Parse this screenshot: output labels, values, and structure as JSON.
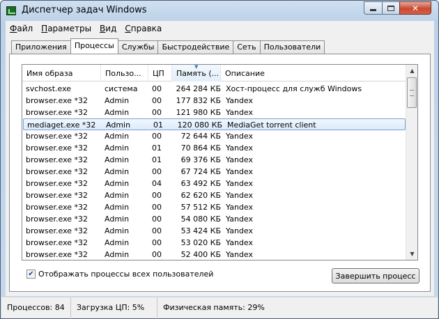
{
  "window": {
    "title": "Диспетчер задач Windows"
  },
  "menu": [
    {
      "pre": "",
      "key": "Ф",
      "post": "айл"
    },
    {
      "pre": "",
      "key": "П",
      "post": "араметры"
    },
    {
      "pre": "",
      "key": "В",
      "post": "ид"
    },
    {
      "pre": "",
      "key": "С",
      "post": "правка"
    }
  ],
  "tabs": [
    "Приложения",
    "Процессы",
    "Службы",
    "Быстродействие",
    "Сеть",
    "Пользователи"
  ],
  "active_tab": "Процессы",
  "columns": [
    "Имя образа",
    "Пользо...",
    "ЦП",
    "Память (...",
    "Описание"
  ],
  "rows": [
    [
      "svchost.exe",
      "система",
      "00",
      "264 284 КБ",
      "Хост-процесс для служб Windows"
    ],
    [
      "browser.exe *32",
      "Admin",
      "00",
      "177 832 КБ",
      "Yandex"
    ],
    [
      "browser.exe *32",
      "Admin",
      "00",
      "121 980 КБ",
      "Yandex"
    ],
    [
      "mediaget.exe *32",
      "Admin",
      "01",
      "120 080 КБ",
      "MediaGet torrent client"
    ],
    [
      "browser.exe *32",
      "Admin",
      "00",
      "72 644 КБ",
      "Yandex"
    ],
    [
      "browser.exe *32",
      "Admin",
      "01",
      "70 864 КБ",
      "Yandex"
    ],
    [
      "browser.exe *32",
      "Admin",
      "01",
      "69 376 КБ",
      "Yandex"
    ],
    [
      "browser.exe *32",
      "Admin",
      "00",
      "67 724 КБ",
      "Yandex"
    ],
    [
      "browser.exe *32",
      "Admin",
      "04",
      "63 492 КБ",
      "Yandex"
    ],
    [
      "browser.exe *32",
      "Admin",
      "00",
      "62 620 КБ",
      "Yandex"
    ],
    [
      "browser.exe *32",
      "Admin",
      "00",
      "57 512 КБ",
      "Yandex"
    ],
    [
      "browser.exe *32",
      "Admin",
      "00",
      "54 080 КБ",
      "Yandex"
    ],
    [
      "browser.exe *32",
      "Admin",
      "00",
      "53 424 КБ",
      "Yandex"
    ],
    [
      "browser.exe *32",
      "Admin",
      "00",
      "53 020 КБ",
      "Yandex"
    ],
    [
      "browser.exe *32",
      "Admin",
      "00",
      "52 400 КБ",
      "Yandex"
    ]
  ],
  "selected_row": 3,
  "show_all": {
    "label": "Отображать процессы всех пользователей",
    "checked": true
  },
  "end_process_label": "Завершить процесс",
  "status": {
    "processes": "Процессов: 84",
    "cpu": "Загрузка ЦП: 5%",
    "memory": "Физическая память: 29%"
  },
  "colors": {
    "selection_border": "#7da2ce",
    "selection_fill": "#dcebfc"
  }
}
